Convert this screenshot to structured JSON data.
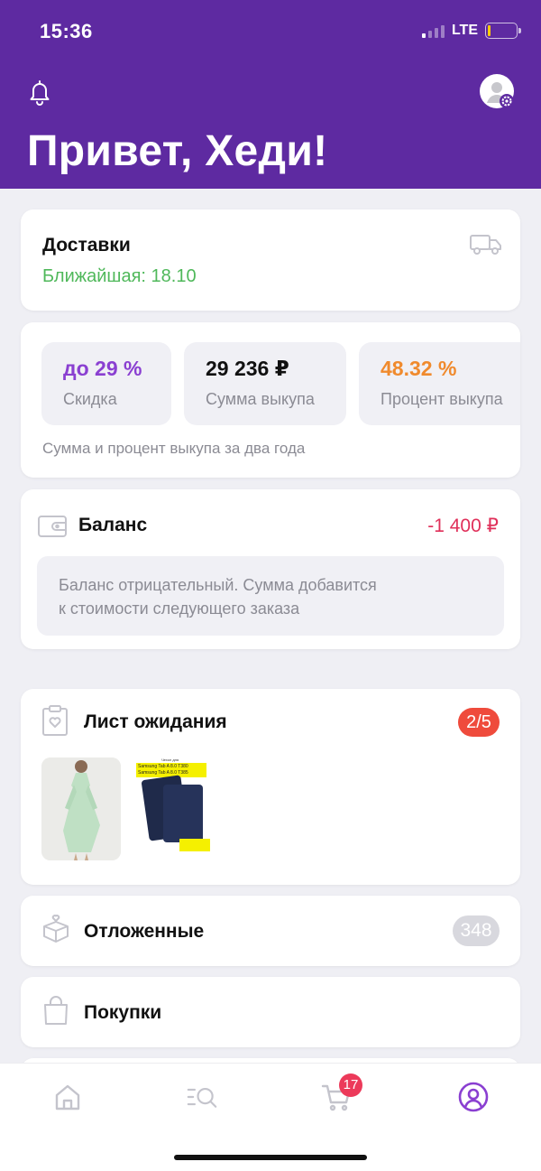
{
  "status": {
    "time": "15:36",
    "network": "LTE"
  },
  "header": {
    "greeting": "Привет, Хеди!"
  },
  "deliveries": {
    "title": "Доставки",
    "nearest": "Ближайшая: 18.10"
  },
  "stats": {
    "items": [
      {
        "value": "до 29 %",
        "label": "Скидка",
        "color": "#8a3fd1"
      },
      {
        "value": "29 236 ₽",
        "label": "Сумма выкупа",
        "color": "#111111"
      },
      {
        "value": "48.32 %",
        "label": "Процент выкупа",
        "color": "#f08a2d"
      }
    ],
    "note": "Сумма и процент выкупа за два года"
  },
  "balance": {
    "title": "Баланс",
    "amount": "-1 400 ₽",
    "note_line1": "Баланс отрицательный. Сумма добавится",
    "note_line2": "к стоимости следующего заказа"
  },
  "waitlist": {
    "title": "Лист ожидания",
    "count": "2/5",
    "product2_caption_1": "Чехол для",
    "product2_caption_2": "Samsung Tab A 8.0 T380",
    "product2_caption_3": "Samsung Tab A 8.0 T385"
  },
  "deferred": {
    "title": "Отложенные",
    "count": "348"
  },
  "purchases": {
    "title": "Покупки"
  },
  "tabbar": {
    "cart_count": "17",
    "active_color": "#8a3fd1",
    "icons": [
      "home-icon",
      "catalog-search-icon",
      "cart-icon",
      "profile-icon"
    ]
  }
}
